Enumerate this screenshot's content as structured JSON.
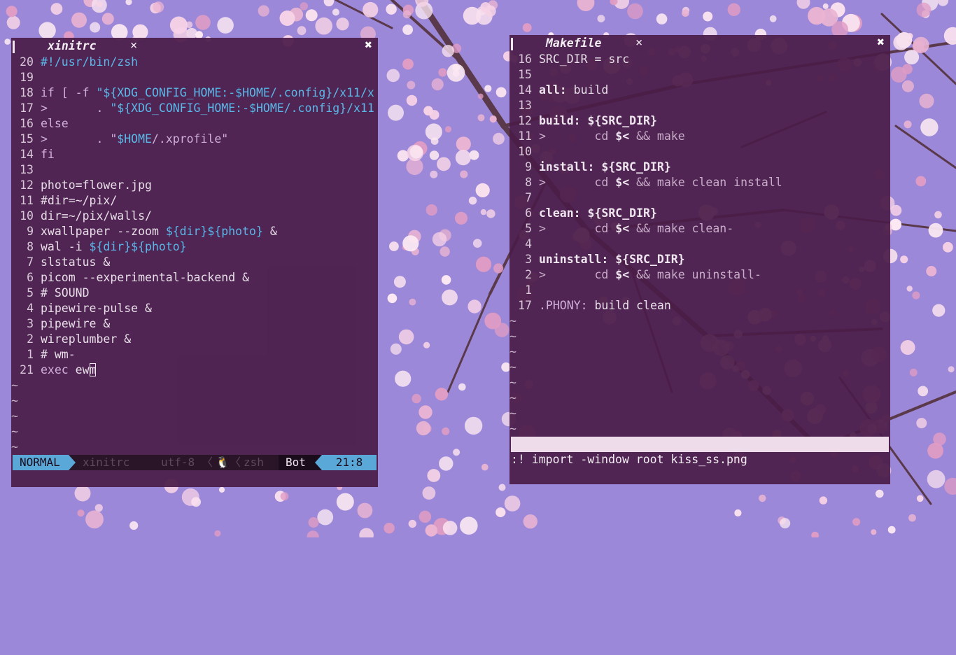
{
  "colors": {
    "wallpaper_sky": "#9c88d8",
    "window_bg": "#4a1c48",
    "accent_blue": "#5aa8d8",
    "blossom_pink": "#f0c4dc",
    "branch_brown": "#5a3a4a"
  },
  "left_window": {
    "tab_title": "xinitrc",
    "tab_close_icon": "×",
    "window_close_icon": "✖",
    "lines": [
      {
        "num": "20",
        "parts": [
          {
            "t": "#!/usr/bin/zsh",
            "c": "s"
          }
        ]
      },
      {
        "num": "19",
        "parts": []
      },
      {
        "num": "18",
        "parts": [
          {
            "t": "if [ -f ",
            "c": "k"
          },
          {
            "t": "\"${XDG_CONFIG_HOME:-$HOME/.config}",
            "c": "s"
          },
          {
            "t": "/x11/x",
            "c": "s"
          }
        ]
      },
      {
        "num": "17",
        "parts": [
          {
            "t": ">       . ",
            "c": "k"
          },
          {
            "t": "\"${XDG_CONFIG_HOME:-$HOME/.config}",
            "c": "s"
          },
          {
            "t": "/x11",
            "c": "s"
          }
        ]
      },
      {
        "num": "16",
        "parts": [
          {
            "t": "else",
            "c": "k"
          }
        ]
      },
      {
        "num": "15",
        "parts": [
          {
            "t": ">       . \"",
            "c": "k"
          },
          {
            "t": "$HOME",
            "c": "s"
          },
          {
            "t": "/.xprofile\"",
            "c": "k"
          }
        ]
      },
      {
        "num": "14",
        "parts": [
          {
            "t": "fi",
            "c": "k"
          }
        ]
      },
      {
        "num": "13",
        "parts": []
      },
      {
        "num": "12",
        "parts": [
          {
            "t": "photo=flower.jpg",
            "c": ""
          }
        ]
      },
      {
        "num": "11",
        "parts": [
          {
            "t": "#dir=~/pix/",
            "c": ""
          }
        ]
      },
      {
        "num": "10",
        "parts": [
          {
            "t": "dir=~/pix/walls/",
            "c": ""
          }
        ]
      },
      {
        "num": "9",
        "parts": [
          {
            "t": "xwallpaper --zoom ",
            "c": ""
          },
          {
            "t": "${dir}${photo}",
            "c": "s"
          },
          {
            "t": " &",
            "c": ""
          }
        ]
      },
      {
        "num": "8",
        "parts": [
          {
            "t": "wal -i ",
            "c": ""
          },
          {
            "t": "${dir}${photo}",
            "c": "s"
          }
        ]
      },
      {
        "num": "7",
        "parts": [
          {
            "t": "slstatus &",
            "c": ""
          }
        ]
      },
      {
        "num": "6",
        "parts": [
          {
            "t": "picom --experimental-backend &",
            "c": ""
          }
        ]
      },
      {
        "num": "5",
        "parts": [
          {
            "t": "# SOUND",
            "c": ""
          }
        ]
      },
      {
        "num": "4",
        "parts": [
          {
            "t": "pipewire-pulse &",
            "c": ""
          }
        ]
      },
      {
        "num": "3",
        "parts": [
          {
            "t": "pipewire &",
            "c": ""
          }
        ]
      },
      {
        "num": "2",
        "parts": [
          {
            "t": "wireplumber &",
            "c": ""
          }
        ]
      },
      {
        "num": "1",
        "parts": [
          {
            "t": "# wm-",
            "c": ""
          }
        ]
      },
      {
        "num": "21",
        "parts": [
          {
            "t": "exec ",
            "c": "k"
          },
          {
            "t": "ew",
            "c": ""
          },
          {
            "t": "m",
            "c": "cursor"
          }
        ]
      }
    ],
    "tilde_count": 5,
    "statusline": {
      "mode": "NORMAL",
      "file": "xinitrc",
      "encoding": "utf-8",
      "sep": "〈",
      "os_icon": "🐧",
      "filetype": "zsh",
      "scroll": "Bot",
      "position": "21:8"
    }
  },
  "right_window": {
    "tab_title": "Makefile",
    "tab_close_icon": "×",
    "window_close_icon": "✖",
    "lines": [
      {
        "num": "16",
        "parts": [
          {
            "t": "SRC_DIR = src",
            "c": ""
          }
        ]
      },
      {
        "num": "15",
        "parts": []
      },
      {
        "num": "14",
        "parts": [
          {
            "t": "all:",
            "c": "kw"
          },
          {
            "t": " build",
            "c": ""
          }
        ]
      },
      {
        "num": "13",
        "parts": []
      },
      {
        "num": "12",
        "parts": [
          {
            "t": "build:",
            "c": "kw"
          },
          {
            "t": " ${SRC_DIR}",
            "c": "kw"
          }
        ]
      },
      {
        "num": "11",
        "parts": [
          {
            "t": ">       cd ",
            "c": "dim"
          },
          {
            "t": "$<",
            "c": "kw"
          },
          {
            "t": " && make",
            "c": "dim"
          }
        ]
      },
      {
        "num": "10",
        "parts": []
      },
      {
        "num": "9",
        "parts": [
          {
            "t": "install:",
            "c": "kw"
          },
          {
            "t": " ${SRC_DIR}",
            "c": "kw"
          }
        ]
      },
      {
        "num": "8",
        "parts": [
          {
            "t": ">       cd ",
            "c": "dim"
          },
          {
            "t": "$<",
            "c": "kw"
          },
          {
            "t": " && make clean install",
            "c": "dim"
          }
        ]
      },
      {
        "num": "7",
        "parts": []
      },
      {
        "num": "6",
        "parts": [
          {
            "t": "clean:",
            "c": "kw"
          },
          {
            "t": " ${SRC_DIR}",
            "c": "kw"
          }
        ]
      },
      {
        "num": "5",
        "parts": [
          {
            "t": ">       cd ",
            "c": "dim"
          },
          {
            "t": "$<",
            "c": "kw"
          },
          {
            "t": " && make clean-",
            "c": "dim"
          }
        ]
      },
      {
        "num": "4",
        "parts": []
      },
      {
        "num": "3",
        "parts": [
          {
            "t": "uninstall:",
            "c": "kw"
          },
          {
            "t": " ${SRC_DIR}",
            "c": "kw"
          }
        ]
      },
      {
        "num": "2",
        "parts": [
          {
            "t": ">       cd ",
            "c": "dim"
          },
          {
            "t": "$<",
            "c": "kw"
          },
          {
            "t": " && make uninstall-",
            "c": "dim"
          }
        ]
      },
      {
        "num": "1",
        "parts": []
      },
      {
        "num": "17",
        "parts": [
          {
            "t": ".PHONY:",
            "c": "k"
          },
          {
            "t": " build clean",
            "c": ""
          }
        ]
      }
    ],
    "tilde_count": 8,
    "command_line": ":! import -window root kiss_ss.png"
  }
}
